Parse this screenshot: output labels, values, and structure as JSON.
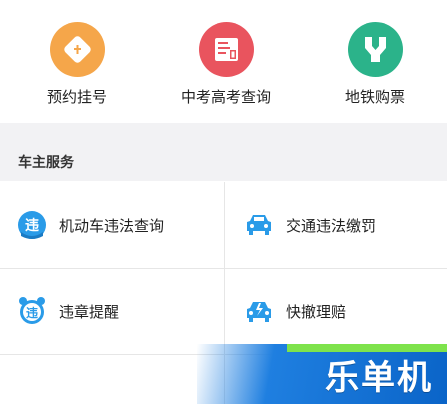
{
  "top_services": [
    {
      "label": "预约挂号",
      "icon": "appointment-icon",
      "color": "#f5a64a"
    },
    {
      "label": "中考高考查询",
      "icon": "exam-icon",
      "color": "#e9545e"
    },
    {
      "label": "地铁购票",
      "icon": "metro-icon",
      "color": "#2bb38a"
    }
  ],
  "section": {
    "title": "车主服务"
  },
  "car_services": [
    {
      "label": "机动车违法查询",
      "icon": "violation-query-icon"
    },
    {
      "label": "交通违法缴罚",
      "icon": "car-icon"
    },
    {
      "label": "违章提醒",
      "icon": "alarm-clock-icon"
    },
    {
      "label": "快撤理赔",
      "icon": "claim-car-icon"
    }
  ],
  "watermark": {
    "text": "乐单机"
  },
  "colors": {
    "accent_blue": "#2a9be8",
    "background_gray": "#f2f2f4"
  }
}
